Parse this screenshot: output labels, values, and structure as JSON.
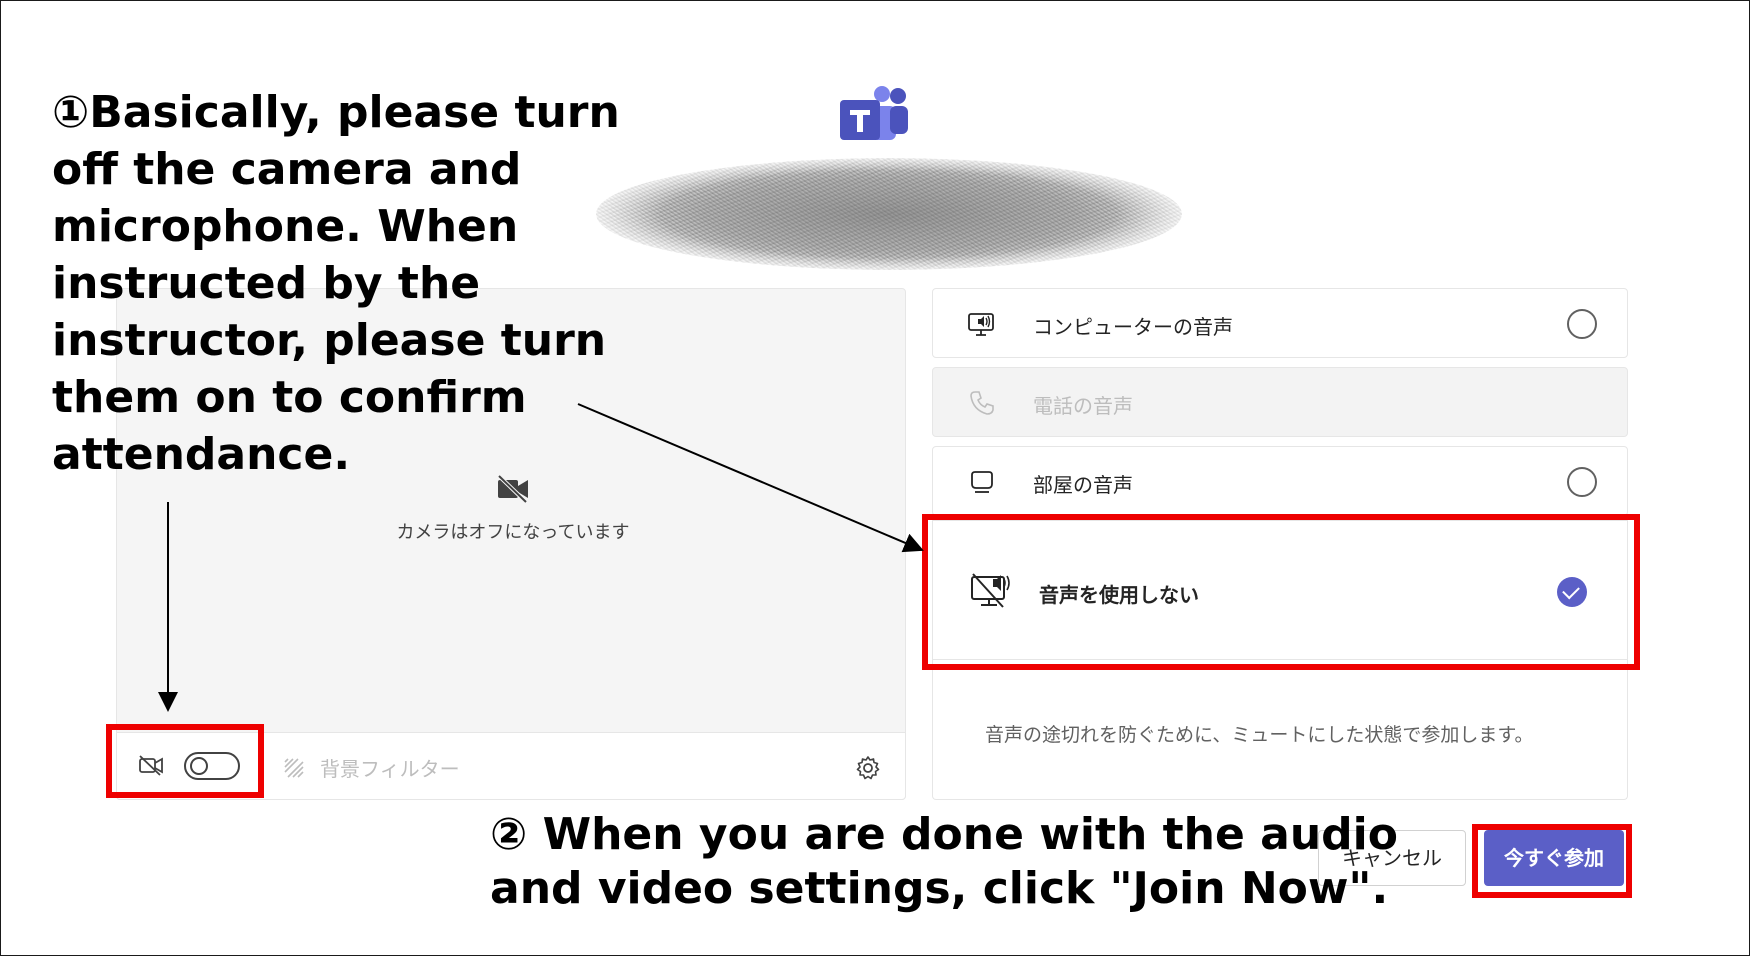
{
  "annotations": {
    "step1": "①Basically, please turn off the camera and microphone. When instructed by the instructor, please turn them on to confirm attendance.",
    "step2": "② When you are done with the audio and video settings, click \"Join Now\"."
  },
  "preview": {
    "camera_status": "カメラはオフになっています",
    "camera_toggle_on": false,
    "background_filter_label": "背景フィルター"
  },
  "audio_options": [
    {
      "label": "コンピューターの音声",
      "icon": "computer-audio-icon",
      "selected": false,
      "disabled": false
    },
    {
      "label": "電話の音声",
      "icon": "phone-icon",
      "selected": false,
      "disabled": true
    },
    {
      "label": "部屋の音声",
      "icon": "room-audio-icon",
      "selected": false,
      "disabled": false
    },
    {
      "label": "音声を使用しない",
      "icon": "audio-off-icon",
      "selected": true,
      "disabled": false
    }
  ],
  "audio_note": "音声の途切れを防ぐために、ミュートにした状態で参加します。",
  "buttons": {
    "cancel": "キャンセル",
    "join_now": "今すぐ参加"
  },
  "colors": {
    "accent": "#5b5fc7",
    "highlight": "#ee0000"
  }
}
